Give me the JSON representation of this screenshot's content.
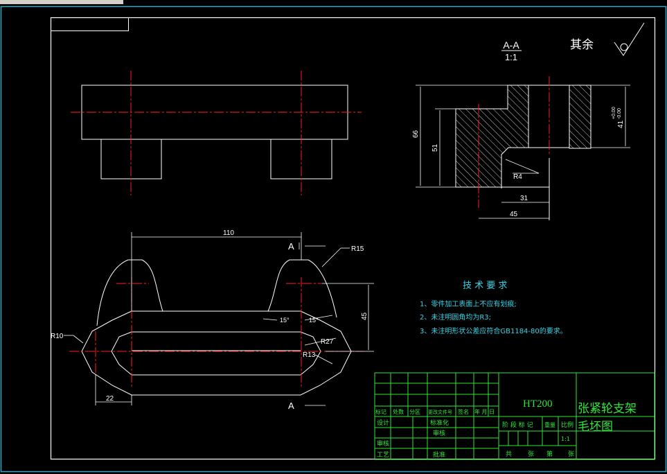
{
  "section": {
    "name": "A-A",
    "scale": "1:1"
  },
  "finish": {
    "text": "其余"
  },
  "dimensions": {
    "d110": "110",
    "d45": "45",
    "d22": "22",
    "r15": "R15",
    "r10": "R10",
    "r27": "R27",
    "r13": "R13",
    "a15_left": "15°",
    "a15_right": "15°",
    "d66": "66",
    "d51": "51",
    "d41": "41",
    "tol_upper": "+0.00",
    "tol_lower": "-0.00",
    "r4": "R4",
    "d31": "31",
    "d45b": "45",
    "cut_top": "A",
    "cut_bottom": "A"
  },
  "tech_requirements": {
    "title": "技 术 要 求",
    "items": [
      "1、零件加工表面上不应有划痕;",
      "2、未注明圆角均为R3;",
      "3、未注明形状公差应符合GB1184-80的要求。"
    ]
  },
  "title_block": {
    "material": "HT200",
    "part_name_1": "张紧轮支架",
    "part_name_2": "毛坯图",
    "row_labels": [
      "标记",
      "处数",
      "分区",
      "更改文件号",
      "签名",
      "年 月 日"
    ],
    "design": "设计",
    "standardize": "标准化",
    "check": "审核",
    "process": "工艺",
    "review": "审核",
    "approve": "批准",
    "stage_label": "阶 段 标 记",
    "weight": "重量",
    "scale_label": "比例",
    "scale_value": "1:1",
    "sheets": [
      "共",
      "张",
      "第",
      "张"
    ]
  },
  "colors": {
    "background": "#000000",
    "line": "#ffffff",
    "center": "#ff2020",
    "frame_text": "#2ee83a",
    "note": "#35d4e6"
  }
}
